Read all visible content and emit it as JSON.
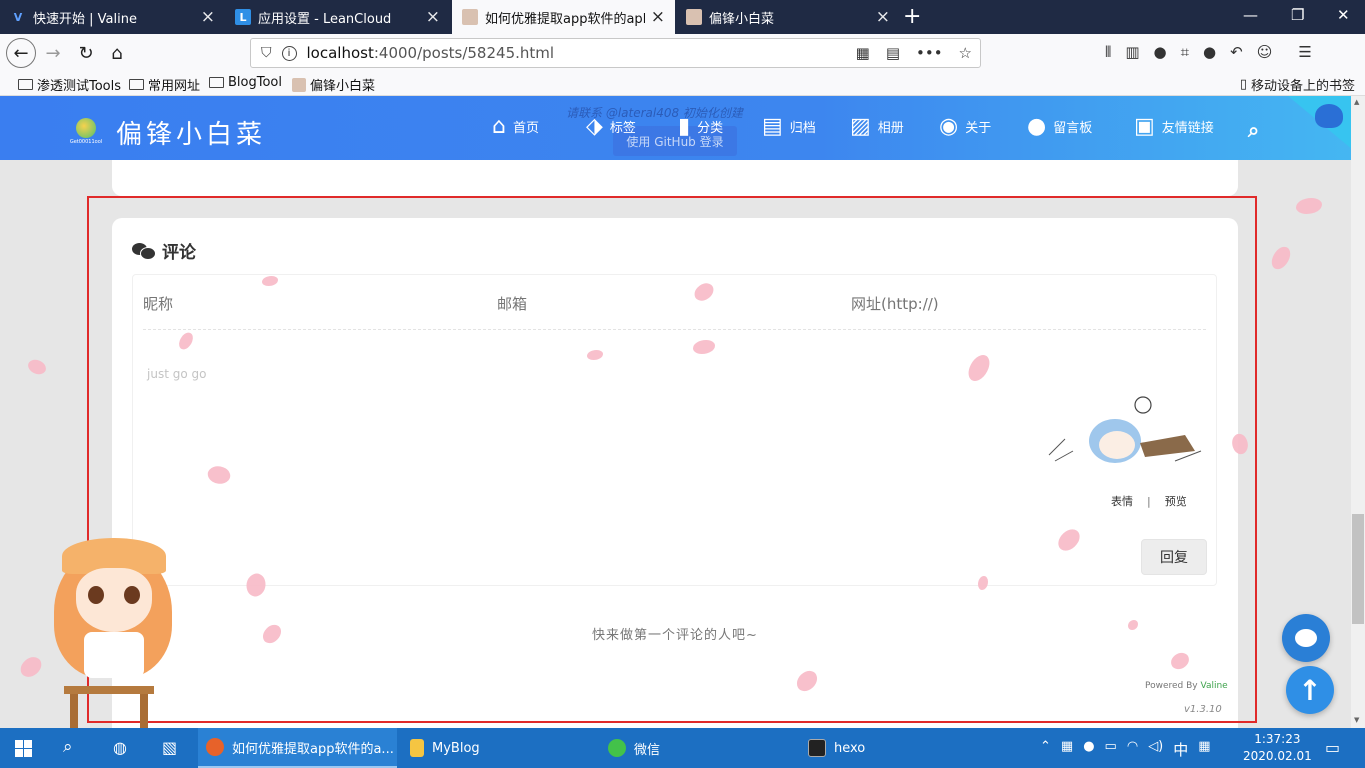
{
  "tabs": [
    {
      "title": "快速开始 | Valine",
      "favicon": "valine-icon"
    },
    {
      "title": "应用设置 - LeanCloud",
      "favicon": "leancloud-icon"
    },
    {
      "title": "如何优雅提取app软件的apk格",
      "favicon": "avatar-icon"
    },
    {
      "title": "偏锋小白菜",
      "favicon": "avatar-icon"
    }
  ],
  "address": {
    "host": "localhost",
    "rest": ":4000/posts/58245.html"
  },
  "bookmarks": [
    "渗透测试Tools",
    "常用网址",
    "BlogTool",
    "偏锋小白菜"
  ],
  "mobile_bookmarks": "移动设备上的书签",
  "site": {
    "title": "偏锋小白菜",
    "logo_sub": "Get00011ool",
    "menu": [
      "首页",
      "标签",
      "分类",
      "归档",
      "相册",
      "关于",
      "留言板",
      "友情链接"
    ],
    "ghost_text": "请联系 @lateral408 初始化创建",
    "ghost_button": "使用 GitHub 登录"
  },
  "comments": {
    "title": "评论",
    "nick_placeholder": "昵称",
    "mail_placeholder": "邮箱",
    "link_placeholder": "网址(http://)",
    "text_placeholder": "just go go",
    "emoji": "表情",
    "preview": "预览",
    "reply": "回复",
    "empty": "快来做第一个评论的人吧~",
    "powered_by": "Powered By",
    "powered_name": "Valine",
    "version": "v1.3.10"
  },
  "taskbar": {
    "items": [
      "如何优雅提取app软件的a...",
      "MyBlog",
      "微信",
      "hexo"
    ],
    "ime": "中",
    "time": "1:37:23",
    "date": "2020.02.01"
  },
  "colors": {
    "header": "#3a7ef0",
    "highlight": "#e02a2a",
    "taskbar": "#1c6fc2"
  }
}
